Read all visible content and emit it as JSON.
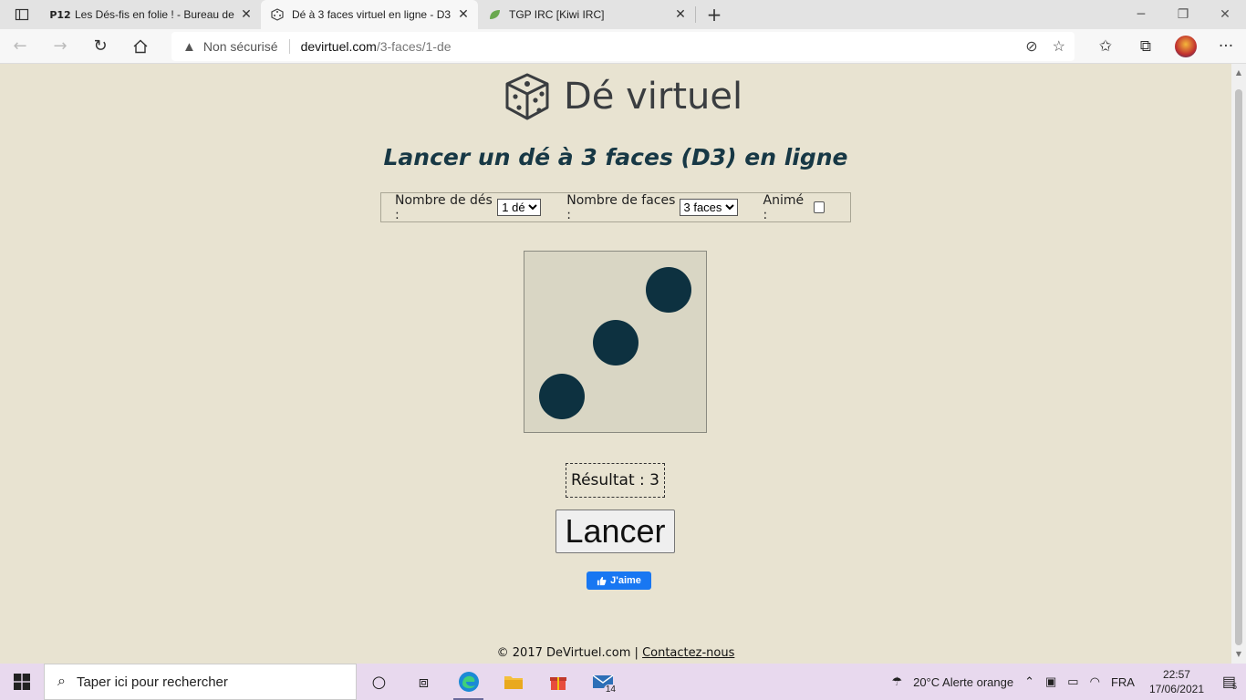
{
  "browser": {
    "tabs": [
      {
        "favicon": "P12",
        "title": "Les Dés-fis en folie ! - Bureau de",
        "active": false
      },
      {
        "favicon": "dice-icon",
        "title": "Dé à 3 faces virtuel en ligne - D3",
        "active": true
      },
      {
        "favicon": "leaf-icon",
        "title": "TGP IRC [Kiwi IRC]",
        "active": false
      }
    ],
    "new_tab": "+",
    "security_label": "Non sécurisé",
    "url_host": "devirtuel.com",
    "url_path": "/3-faces/1-de"
  },
  "page": {
    "logo_text": "Dé virtuel",
    "subtitle": "Lancer un dé à 3 faces (D3) en ligne",
    "options": {
      "dice_count_label": "Nombre de dés :",
      "dice_count_value": "1 dé",
      "faces_label": "Nombre de faces :",
      "faces_value": "3 faces",
      "animated_label": "Animé :"
    },
    "die_face_value": 3,
    "result_text": "Résultat : 3",
    "roll_button": "Lancer",
    "like_button": "J'aime",
    "footer_copyright": "© 2017 DeVirtuel.com |",
    "footer_contact": "Contactez-nous"
  },
  "taskbar": {
    "search_placeholder": "Taper ici pour rechercher",
    "mail_badge": "14",
    "weather": "20°C  Alerte orange",
    "language": "FRA",
    "time": "22:57",
    "date": "17/06/2021",
    "notification_count": "5"
  },
  "colors": {
    "page_bg": "#e8e3d1",
    "die_bg": "#d9d6c4",
    "pip": "#0d3140",
    "subtitle": "#173845",
    "like_blue": "#1877f2"
  }
}
